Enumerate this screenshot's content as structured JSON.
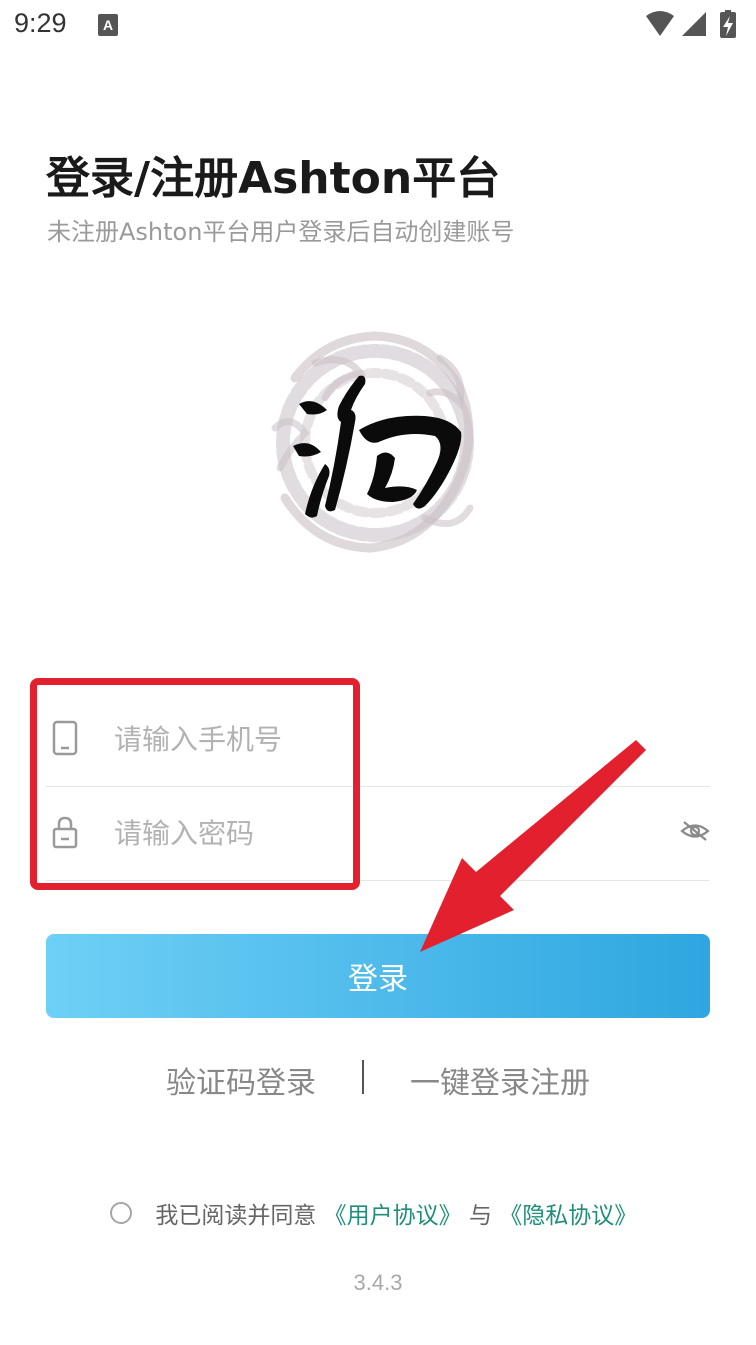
{
  "status_bar": {
    "time": "9:29",
    "notification_icon": "a-icon",
    "icons": [
      "wifi-icon",
      "signal-icon",
      "battery-charging-icon"
    ]
  },
  "header": {
    "title": "登录/注册Ashton平台",
    "subtitle": "未注册Ashton平台用户登录后自动创建账号"
  },
  "logo": {
    "icon": "calligraphy-dragon-logo"
  },
  "form": {
    "phone": {
      "placeholder": "请输入手机号",
      "value": "",
      "icon": "phone-icon"
    },
    "password": {
      "placeholder": "请输入密码",
      "value": "",
      "icon": "lock-icon",
      "toggle_icon": "eye-hidden-icon"
    },
    "login_button": "登录"
  },
  "alt_login": {
    "sms_login": "验证码登录",
    "one_key_login": "一键登录注册"
  },
  "agreement": {
    "checked": false,
    "prefix": "我已阅读并同意",
    "user_agreement": "《用户协议》",
    "conjunction": "与",
    "privacy_policy": "《隐私协议》"
  },
  "version": "3.4.3",
  "annotations": {
    "highlight_color": "#e3202d",
    "arrow_color": "#e3202d"
  },
  "colors": {
    "button_gradient_start": "#6fd0f6",
    "button_gradient_end": "#2ea6e0",
    "link": "#1f8f7b"
  }
}
